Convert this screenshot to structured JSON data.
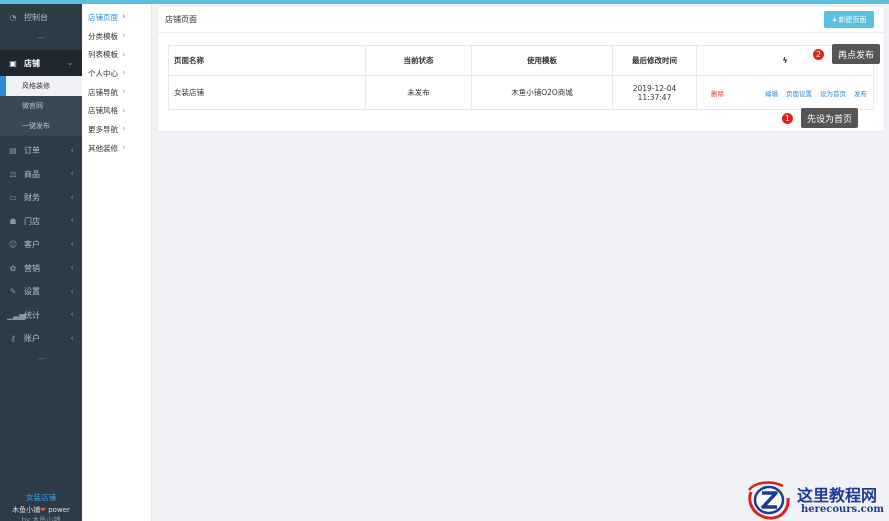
{
  "sidebar": {
    "dashboard": "控制台",
    "shop": "店铺",
    "shop_subs": [
      "风格装修",
      "微官网",
      "一键发布"
    ],
    "items": [
      "订单",
      "商品",
      "财务",
      "门店",
      "客户",
      "营销",
      "设置",
      "统计",
      "账户"
    ],
    "dash_symbol": "—",
    "footer_shop": "女装店铺",
    "footer_power": "木鱼小铺",
    "footer_power_suffix": "power",
    "footer_cut": "by 木鱼小铺"
  },
  "submenu": {
    "items": [
      "店铺页面",
      "分类模板",
      "列表模板",
      "个人中心",
      "店铺导航",
      "店铺风格",
      "更多导航",
      "其他装修"
    ]
  },
  "panel": {
    "title": "店铺页面",
    "new_button": "新建页面",
    "headers": [
      "页面名称",
      "当前状态",
      "使用模板",
      "最后修改时间"
    ],
    "rows": [
      {
        "name": "女装店铺",
        "status": "未发布",
        "template": "木鱼小铺O2O商城",
        "date": "2019-12-04",
        "time": "11:37:47",
        "ops": {
          "delete": "删除",
          "edit": "编辑",
          "settings": "页面设置",
          "set_home": "设为首页",
          "publish": "发布"
        }
      }
    ]
  },
  "callouts": [
    {
      "num": "2",
      "text": "再点发布"
    },
    {
      "num": "1",
      "text": "先设为首页"
    }
  ],
  "watermark": {
    "cn": "这里教程网",
    "en": "herecours.com"
  },
  "colors": {
    "accent": "#5bc0de",
    "link": "#2b8dd6",
    "danger": "#e5362d",
    "sidebar": "#2f3a47",
    "watermark": "#1d3c96"
  }
}
